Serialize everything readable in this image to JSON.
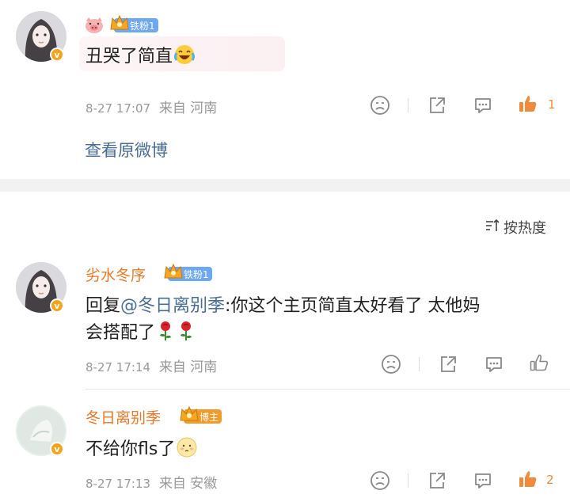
{
  "comment_top": {
    "fan_badge": "铁粉1",
    "text": "丑哭了简直",
    "meta_time": "8-27 17:07",
    "meta_location": "来自 河南",
    "like_count": "1",
    "view_original": "查看原微博"
  },
  "sort_label": "按热度",
  "comment_1": {
    "username": "劣水冬序",
    "fan_badge": "铁粉1",
    "reply_prefix": "回复",
    "mention": "@冬日离别季",
    "text_line1": ":你这个主页简直太好看了 太他妈",
    "text_line2": "会搭配了",
    "meta_time": "8-27 17:14",
    "meta_location": "来自 河南"
  },
  "comment_2": {
    "username": "冬日离别季",
    "badge": "博主",
    "text": "不给你fls了",
    "meta_time": "8-27 17:13",
    "meta_location": "来自 安徽",
    "like_count": "2"
  },
  "colors": {
    "username": "#e8792a",
    "link": "#4a6d95",
    "meta": "#999999",
    "like_active": "#f08a3c",
    "fan_badge": "#6fa8f2",
    "host_badge": "#f39b2a"
  },
  "icons": [
    "pig-icon",
    "crown-icon",
    "laugh-cry-emoji",
    "dislike-icon",
    "share-icon",
    "comment-icon",
    "like-icon",
    "sort-icon",
    "rose-emoji",
    "shy-emoji",
    "verified-badge-icon"
  ]
}
